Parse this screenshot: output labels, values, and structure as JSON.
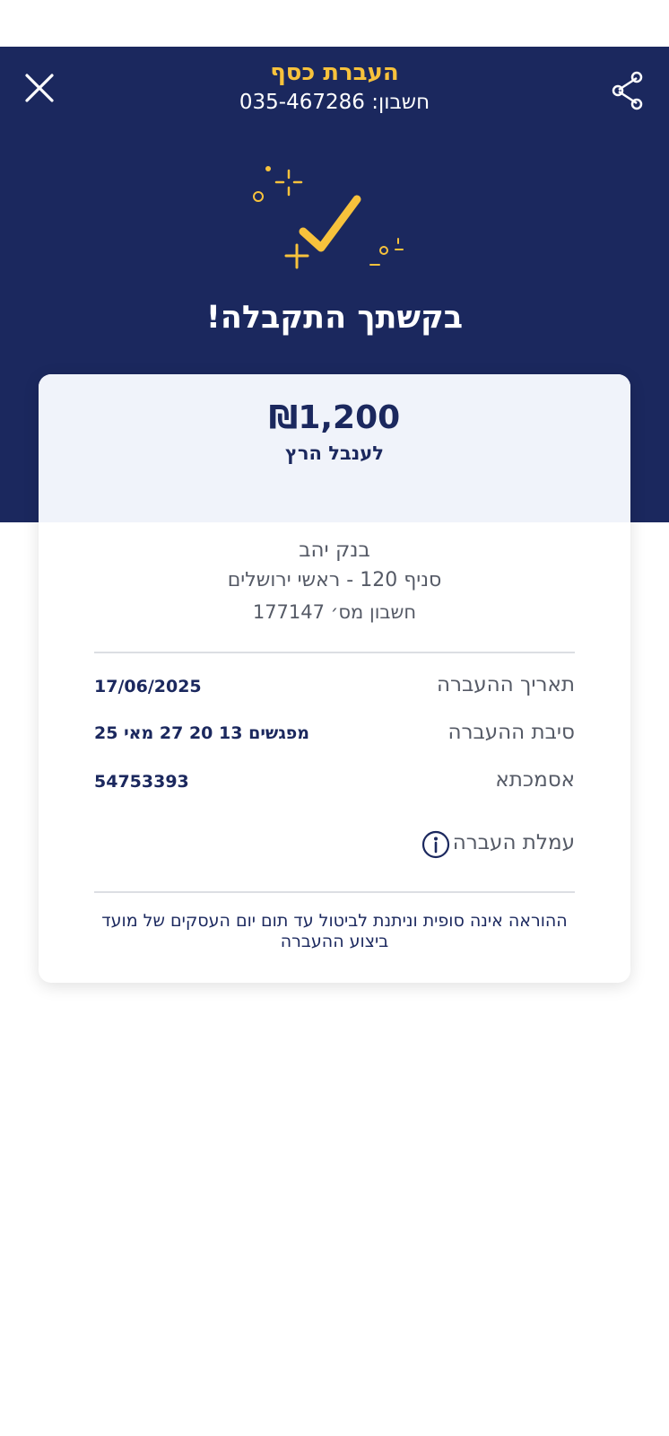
{
  "header": {
    "title": "העברת כסף",
    "account_line": "חשבון: 035-467286",
    "close_icon": "close-icon",
    "share_icon": "share-icon"
  },
  "status": {
    "message": "בקשתך התקבלה!",
    "icon": "success-check-icon"
  },
  "transfer": {
    "amount": "₪1,200",
    "recipient": "לענבל הרץ",
    "bank_name": "בנק יהב",
    "branch": "סניף 120 - ראשי ירושלים",
    "account_number": "חשבון מס׳ 177147"
  },
  "details": [
    {
      "label": "תאריך ההעברה",
      "value": "17/06/2025"
    },
    {
      "label": "סיבת ההעברה",
      "value": "מפגשים 13 20 27 מאי 25"
    },
    {
      "label": "אסמכתא",
      "value": "54753393"
    },
    {
      "label": "עמלת העברה",
      "value": ""
    }
  ],
  "note": "ההוראה אינה סופית וניתנת לביטול עד תום יום העסקים של מועד ביצוע ההעברה",
  "colors": {
    "primary_navy": "#1b285e",
    "accent_yellow": "#f7c23c",
    "card_header_bg": "#f0f3fa"
  }
}
